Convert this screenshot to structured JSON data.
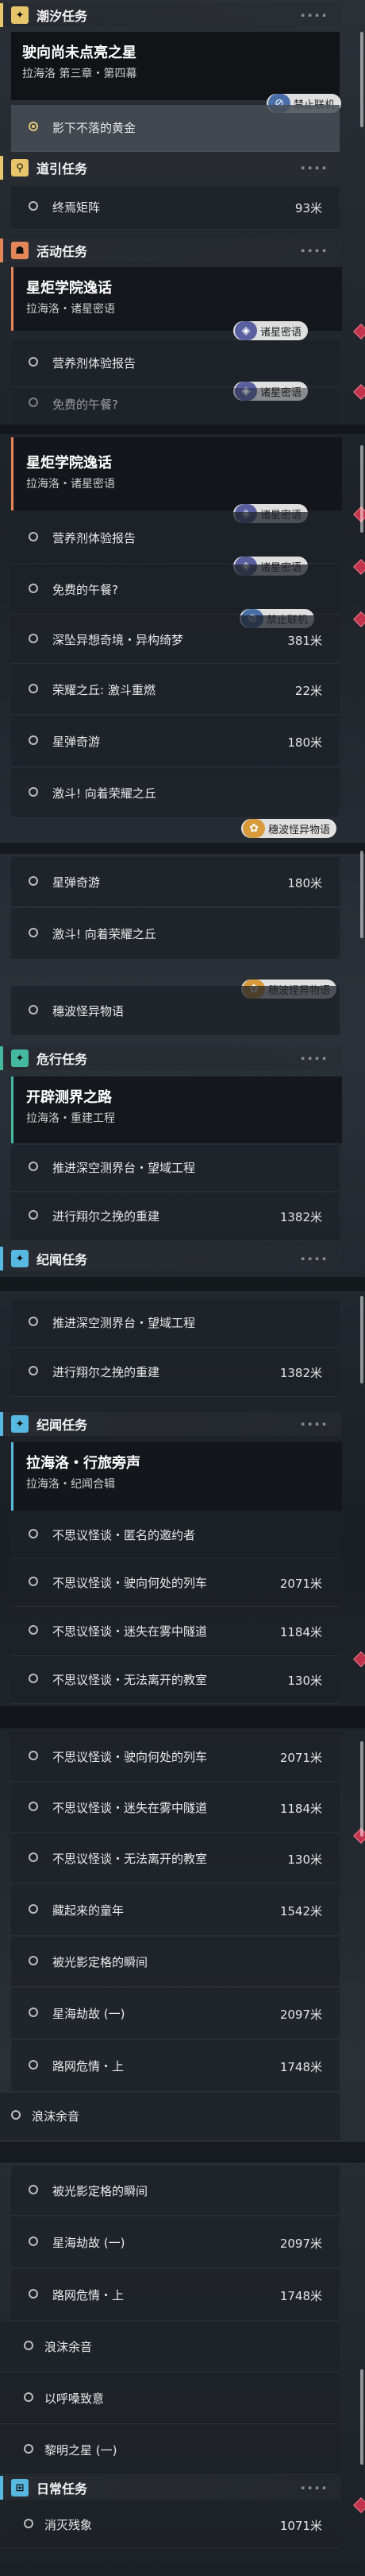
{
  "sections": {
    "chaoxi": {
      "title": "潮汐任务",
      "color": "#e6c56b",
      "icon": "✦"
    },
    "guide": {
      "title": "道引任务",
      "color": "#e6c56b",
      "icon": "⚲"
    },
    "activity": {
      "title": "活动任务",
      "color": "#e3865a",
      "icon": "☗"
    },
    "danger": {
      "title": "危行任务",
      "color": "#45b9a0",
      "icon": "✦"
    },
    "jiwen": {
      "title": "纪闻任务",
      "color": "#57b8e0",
      "icon": "✦"
    },
    "daily": {
      "title": "日常任务",
      "color": "#57b8e0",
      "icon": "⊞"
    }
  },
  "missions": {
    "starry": {
      "name": "驶向尚未点亮之星",
      "sub": "拉海洛 第三章・第四幕"
    },
    "academy": {
      "name": "星炬学院逸话",
      "sub": "拉海洛・诸星密语"
    },
    "explore": {
      "name": "开辟测界之路",
      "sub": "拉海洛・重建工程"
    },
    "travel": {
      "name": "拉海洛・行旅旁声",
      "sub": "拉海洛・纪闻合辑"
    }
  },
  "rows": {
    "shadow_gold": {
      "label": "影下不落的黄金"
    },
    "endless_array": {
      "label": "终焉矩阵",
      "dist": "93米"
    },
    "nutrient_report": {
      "label": "营养剂体验报告"
    },
    "free_lunch": {
      "label": "免费的午餐?"
    },
    "abyss_dream": {
      "label": "深坠异想奇境・异构绮梦",
      "dist": "381米"
    },
    "glory_hill": {
      "label": "荣耀之丘: 激斗重燃",
      "dist": "22米"
    },
    "star_ball": {
      "label": "星弹奇游",
      "dist": "180米"
    },
    "fight_glory": {
      "label": "激斗! 向着荣耀之丘"
    },
    "wave_tale": {
      "label": "穗波怪异物语"
    },
    "deep_space": {
      "label": "推进深空测界台・望域工程"
    },
    "shuoer": {
      "label": "进行翔尔之挽的重建",
      "dist": "1382米"
    },
    "anon_invite": {
      "label": "不思议怪谈・匿名的邀约者"
    },
    "train": {
      "label": "不思议怪谈・驶向何处的列车",
      "dist": "2071米"
    },
    "tunnel": {
      "label": "不思议怪谈・迷失在雾中隧道",
      "dist": "1184米"
    },
    "classroom": {
      "label": "不思议怪谈・无法离开的教室",
      "dist": "130米"
    },
    "hidden_childhood": {
      "label": "藏起来的童年",
      "dist": "1542米"
    },
    "moment": {
      "label": "被光影定格的瞬间"
    },
    "starsea": {
      "label": "星海劫故 (一)",
      "dist": "2097米"
    },
    "crisis": {
      "label": "路网危情・上",
      "dist": "1748米"
    },
    "foam": {
      "label": "浪沫余音"
    },
    "whisper": {
      "label": "以呼嗓致意"
    },
    "dawn": {
      "label": "黎明之星 (一)"
    },
    "remains": {
      "label": "消灭残象",
      "dist": "1071米"
    }
  },
  "badges": {
    "no_coop": "禁止联机",
    "secret": "诸星密语",
    "wave": "穗波怪异物语"
  },
  "colors": {
    "accent": "#e6c56b",
    "alert": "#c2344c",
    "panel": "#14161a"
  }
}
